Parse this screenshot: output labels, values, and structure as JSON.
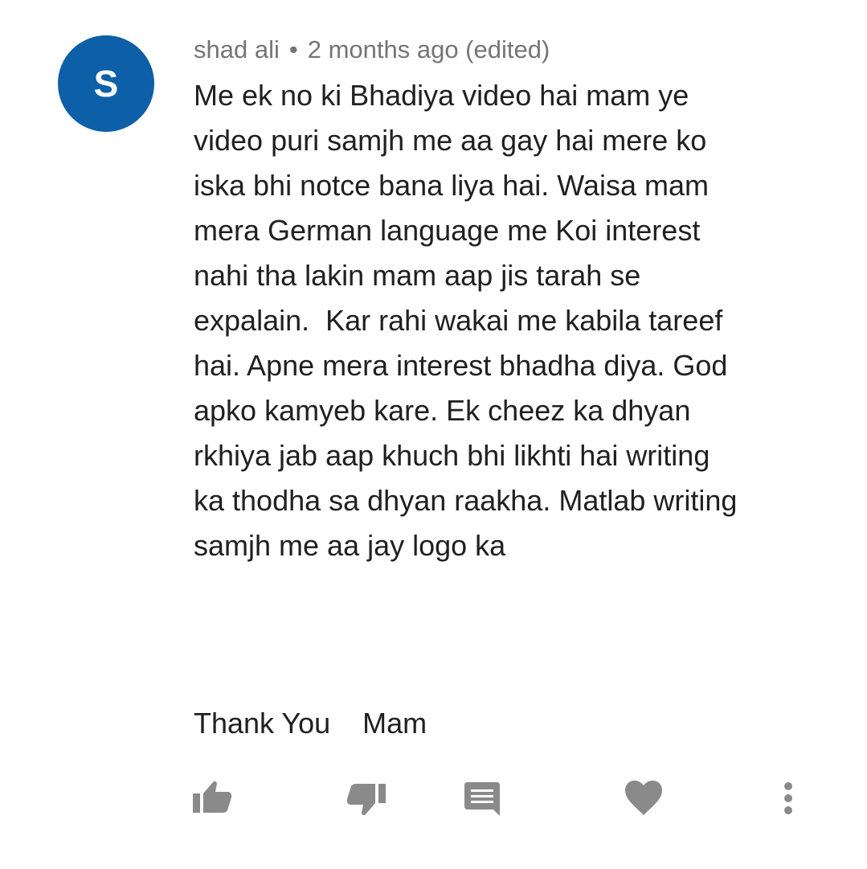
{
  "comment": {
    "avatar_letter": "S",
    "avatar_color": "#0d5fa8",
    "author": "shad ali",
    "separator": "•",
    "timestamp": "2 months ago (edited)",
    "lines": [
      "Me ek no ki Bhadiya video hai mam ye",
      "video puri samjh me aa gay hai mere ko",
      "iska bhi notce bana liya hai. Waisa mam",
      "mera German language me Koi interest",
      "nahi tha lakin mam aap jis tarah se",
      "expalain.  Kar rahi wakai me kabila tareef",
      "hai. Apne mera interest bhadha diya. God",
      "apko kamyeb kare. Ek cheez ka dhyan",
      "rkhiya jab aap khuch bhi likhti hai writing",
      "ka thodha sa dhyan raakha. Matlab writing",
      "samjh me aa jay logo ka"
    ],
    "closing": "Thank You    Mam"
  },
  "actions": {
    "like_icon": "thumbs-up-icon",
    "dislike_icon": "thumbs-down-icon",
    "reply_icon": "comment-icon",
    "heart_icon": "heart-icon",
    "more_icon": "more-vertical-icon",
    "icon_color": "#8a8a8a"
  }
}
